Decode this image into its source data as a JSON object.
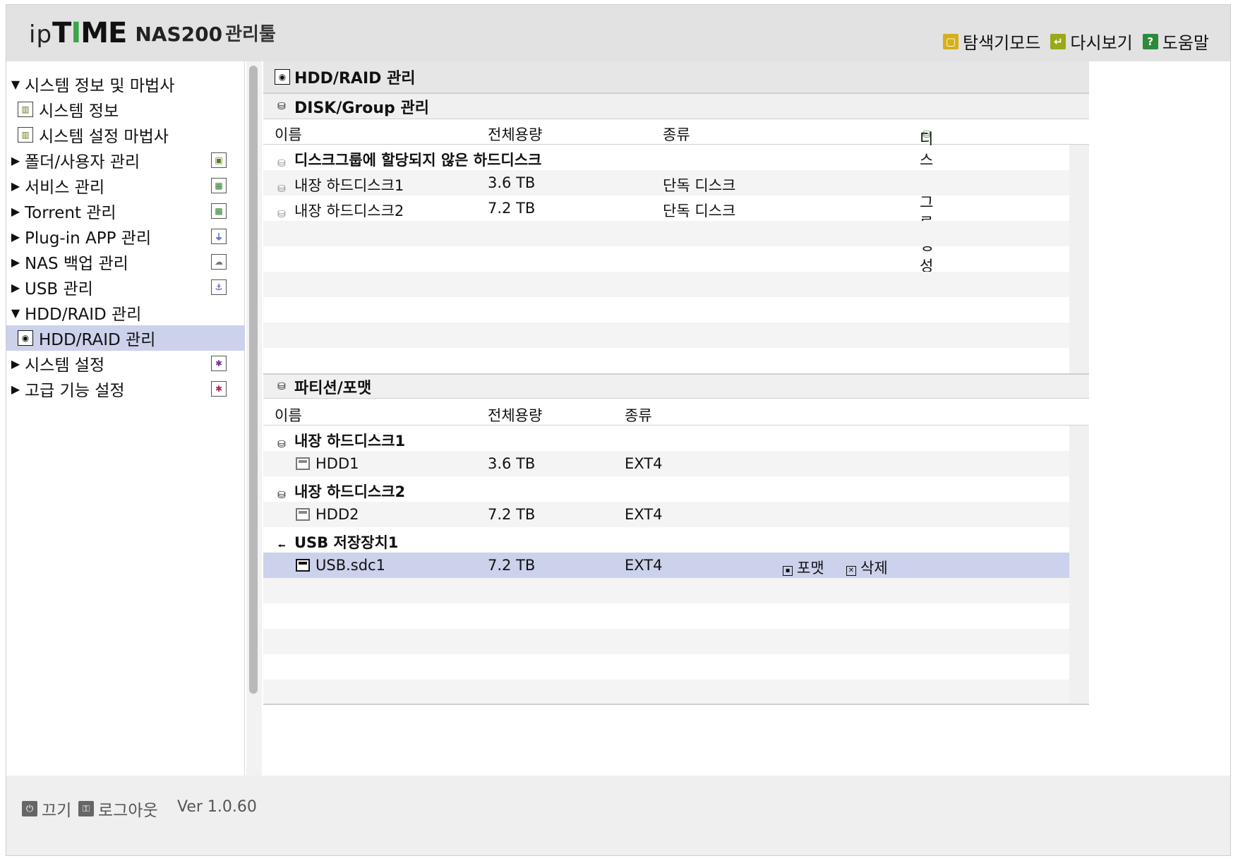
{
  "header": {
    "logo_ip": "ip",
    "logo_time_t": "T",
    "logo_time_i": "I",
    "logo_time_me": "ME",
    "logo_model": "NAS200",
    "logo_tool": "관리툴",
    "links": [
      {
        "label": "탐색기모드",
        "icon": "explorer-icon"
      },
      {
        "label": "다시보기",
        "icon": "refresh-icon"
      },
      {
        "label": "도움말",
        "icon": "help-icon"
      }
    ]
  },
  "nav": {
    "items": [
      {
        "label": "시스템 정보 및 마법사",
        "expanded": true
      },
      {
        "label": "시스템 정보",
        "child": true
      },
      {
        "label": "시스템 설정 마법사",
        "child": true
      },
      {
        "label": "폴더/사용자 관리",
        "badge_color": "#5c7c1e"
      },
      {
        "label": "서비스 관리",
        "badge_color": "#2d7a2d"
      },
      {
        "label": "Torrent 관리",
        "badge_color": "#2d7a2d"
      },
      {
        "label": "Plug-in APP 관리",
        "badge_color": "#4a5fc1"
      },
      {
        "label": "NAS 백업 관리",
        "badge_color": "#777777"
      },
      {
        "label": "USB 관리",
        "badge_color": "#4b2fbf"
      },
      {
        "label": "HDD/RAID 관리",
        "expanded": true
      },
      {
        "label": "HDD/RAID 관리",
        "child": true,
        "selected": true
      },
      {
        "label": "시스템 설정",
        "badge_color": "#7a2d9a"
      },
      {
        "label": "고급 기능 설정",
        "badge_color": "#b0244a"
      }
    ]
  },
  "main": {
    "title": "HDD/RAID 관리",
    "disk_group": {
      "title": "DISK/Group 관리",
      "columns": {
        "name": "이름",
        "capacity": "전체용량",
        "type": "종류",
        "create": "디스크그룹 생성"
      },
      "group_label": "디스크그룹에 할당되지 않은 하드디스크",
      "rows": [
        {
          "name": "내장 하드디스크1",
          "capacity": "3.6 TB",
          "type": "단독 디스크"
        },
        {
          "name": "내장 하드디스크2",
          "capacity": "7.2 TB",
          "type": "단독 디스크"
        }
      ]
    },
    "partition": {
      "title": "파티션/포맷",
      "columns": {
        "name": "이름",
        "capacity": "전체용량",
        "type": "종류"
      },
      "groups": [
        {
          "label": "내장 하드디스크1",
          "part": {
            "name": "HDD1",
            "capacity": "3.6 TB",
            "type": "EXT4"
          }
        },
        {
          "label": "내장 하드디스크2",
          "part": {
            "name": "HDD2",
            "capacity": "7.2 TB",
            "type": "EXT4"
          }
        },
        {
          "label": "USB 저장장치1",
          "part": {
            "name": "USB.sdc1",
            "capacity": "7.2 TB",
            "type": "EXT4",
            "format": "포맷",
            "delete": "삭제"
          }
        }
      ]
    }
  },
  "footer": {
    "power": "끄기",
    "logout": "로그아웃",
    "version": "Ver 1.0.60"
  }
}
